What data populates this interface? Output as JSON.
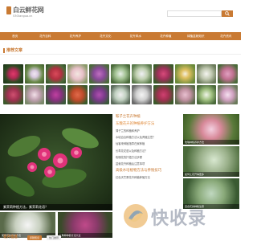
{
  "header": {
    "logo_title": "白云鲜花网",
    "logo_sub": "53Olangua.cn",
    "search_placeholder": ""
  },
  "nav": [
    "首页",
    "花卉百科",
    "花卉养护",
    "花卉文化",
    "花卉风水",
    "花卉种植",
    "绿植盆栽知识",
    "花卉资讯"
  ],
  "section": {
    "title": "推荐文章"
  },
  "feature": {
    "caption": "紫茉莉种植方法，紫茉莉花语？"
  },
  "mid": {
    "head1": "鞍子兰花卉种植",
    "head2": "东魏花卉的种植养护方法",
    "items": [
      "薄子兰的种植和养护",
      "水培百合种植方法以及养殖注意？",
      "仙客来种植指导在家种植",
      "长寿花花语以及种植方法？",
      "玫瑰花的扦插方法步骤",
      "盆栽花卉种植后注意事项"
    ],
    "head3": "高级水培植物方法与养殖技巧",
    "item_last": "红色天竺葵花卉种植养殖方法"
  },
  "right": {
    "cards": [
      {
        "caption": "玫瑰种植养护方法"
      },
      {
        "caption": "如何让花开得更多"
      },
      {
        "caption": "百合花的种植注意"
      }
    ]
  },
  "bottom": {
    "cards": [
      {
        "caption": "茉莉花的养护方法"
      },
      {
        "caption": "三角梅种植方法大全"
      }
    ]
  },
  "tabs": {
    "title": "花卉信息",
    "on": "养殖知识",
    "off": "热门推荐"
  },
  "watermark": {
    "text": "快收录"
  },
  "colors": {
    "accent": "#c97a33"
  }
}
